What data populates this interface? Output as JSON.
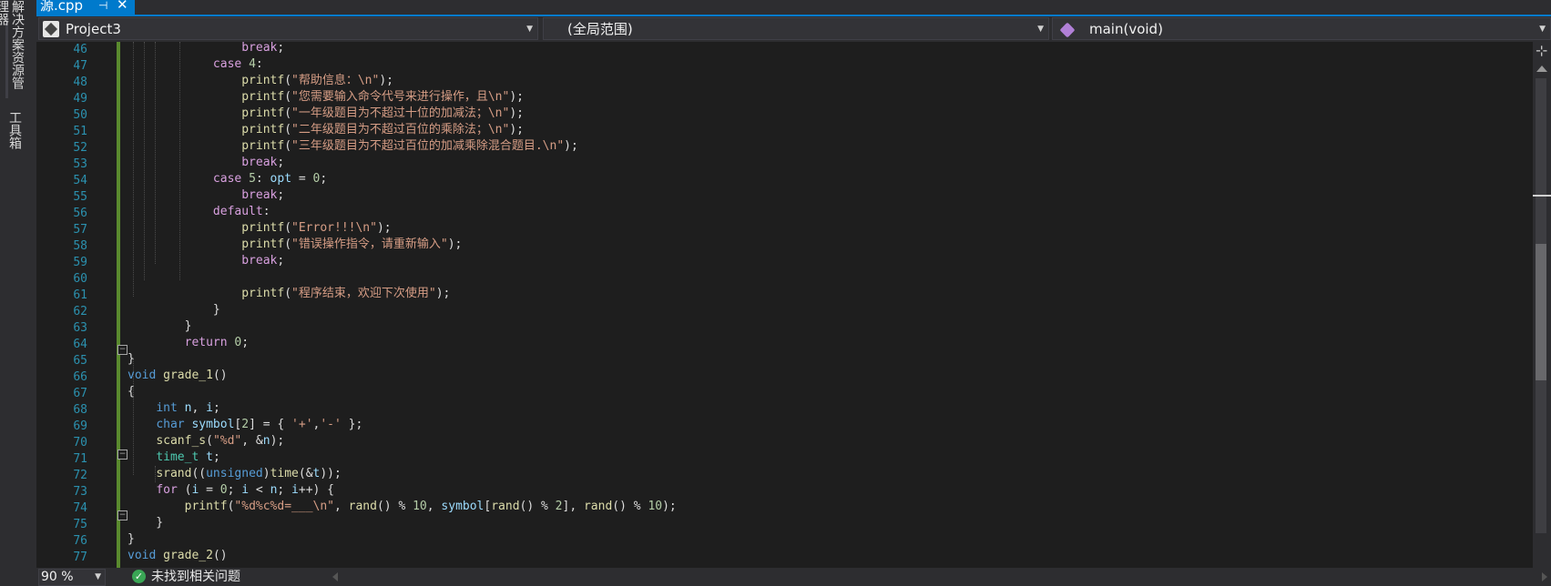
{
  "sidebar": {
    "tabs": [
      {
        "label": "解决方案资源管理器"
      },
      {
        "label": "工具箱"
      }
    ]
  },
  "document_tab": {
    "name": "源.cpp",
    "pin_glyph": "⊣",
    "close_glyph": "✕"
  },
  "navbar": {
    "project": "Project3",
    "scope": "(全局范围)",
    "member": "main(void)"
  },
  "editor": {
    "first_line": 46,
    "last_line": 77
  },
  "status": {
    "zoom": "90 %",
    "issues": "未找到相关问题"
  },
  "colors": {
    "accent": "#007acc",
    "line_number": "#2b91af",
    "keyword": "#569cd6",
    "control_keyword": "#d8a0df",
    "string": "#d69d85",
    "number": "#b5cea8",
    "change_bar": "#5a8a2e",
    "ok": "#3aa655"
  }
}
